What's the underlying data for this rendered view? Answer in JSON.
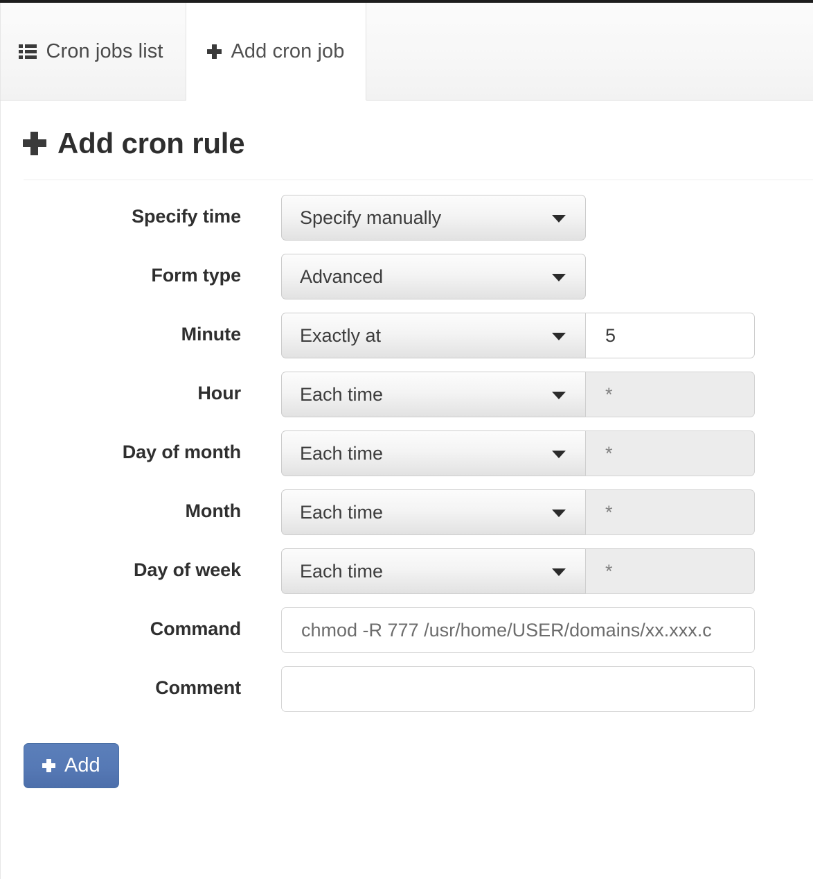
{
  "tabs": [
    {
      "label": "Cron jobs list",
      "icon": "list-icon",
      "active": false
    },
    {
      "label": "Add cron job",
      "icon": "plus-icon",
      "active": true
    }
  ],
  "page": {
    "title": "Add cron rule",
    "title_icon": "plus-icon"
  },
  "form": {
    "rows": [
      {
        "label": "Specify time",
        "type": "select",
        "select_value": "Specify manually"
      },
      {
        "label": "Form type",
        "type": "select",
        "select_value": "Advanced"
      },
      {
        "label": "Minute",
        "type": "select-with-value",
        "select_value": "Exactly at",
        "value": "5",
        "value_disabled": false
      },
      {
        "label": "Hour",
        "type": "select-with-value",
        "select_value": "Each time",
        "value": "*",
        "value_disabled": true
      },
      {
        "label": "Day of month",
        "type": "select-with-value",
        "select_value": "Each time",
        "value": "*",
        "value_disabled": true
      },
      {
        "label": "Month",
        "type": "select-with-value",
        "select_value": "Each time",
        "value": "*",
        "value_disabled": true
      },
      {
        "label": "Day of week",
        "type": "select-with-value",
        "select_value": "Each time",
        "value": "*",
        "value_disabled": true
      },
      {
        "label": "Command",
        "type": "text",
        "value": "chmod -R 777 /usr/home/USER/domains/xx.xxx.c"
      },
      {
        "label": "Comment",
        "type": "text",
        "value": ""
      }
    ]
  },
  "submit": {
    "label": "Add",
    "icon": "plus-icon",
    "color": "#5679b5"
  }
}
